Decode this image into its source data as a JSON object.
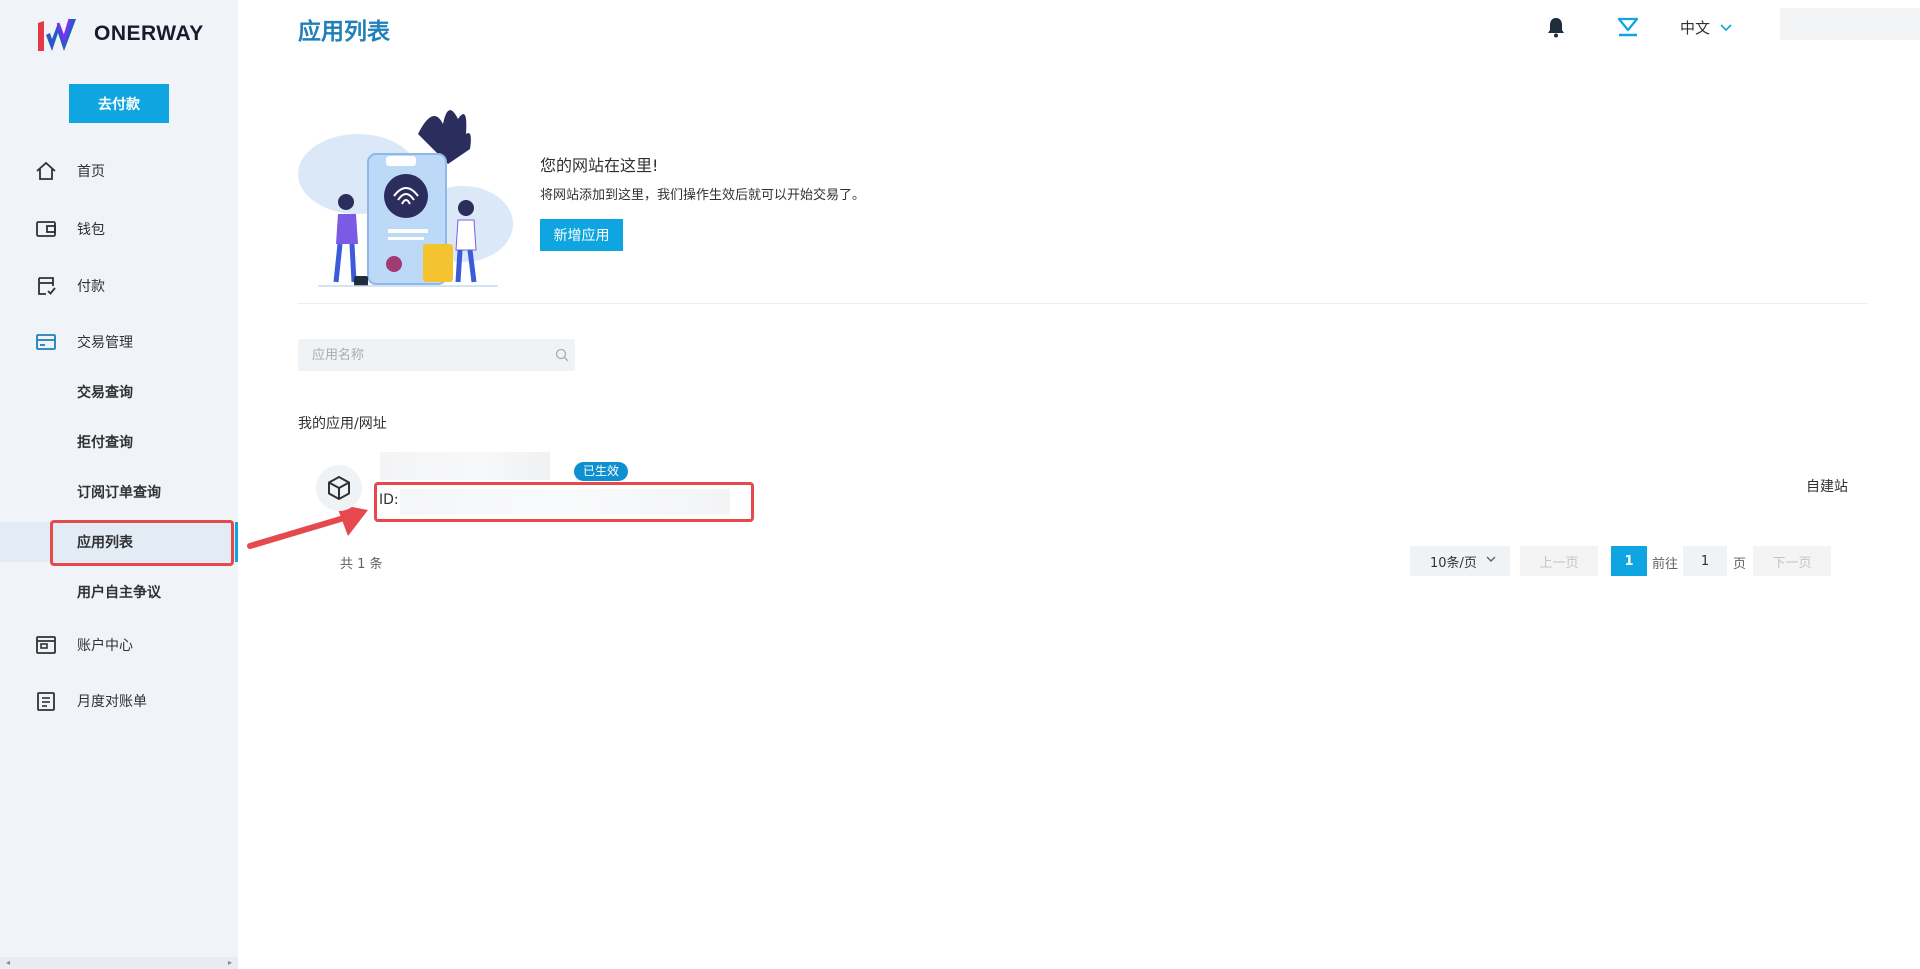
{
  "brand": {
    "name": "ONERWAY",
    "accent": "#0ea5e0",
    "title_color": "#1f7fb8"
  },
  "sidebar": {
    "pay_button": "去付款",
    "items": [
      {
        "label": "首页",
        "icon": "home-icon"
      },
      {
        "label": "钱包",
        "icon": "wallet-icon"
      },
      {
        "label": "付款",
        "icon": "payment-icon"
      },
      {
        "label": "交易管理",
        "icon": "card-icon"
      },
      {
        "label": "账户中心",
        "icon": "account-icon"
      },
      {
        "label": "月度对账单",
        "icon": "statement-icon"
      }
    ],
    "sub_items": [
      {
        "label": "交易查询"
      },
      {
        "label": "拒付查询"
      },
      {
        "label": "订阅订单查询"
      },
      {
        "label": "应用列表",
        "active": true
      },
      {
        "label": "用户自主争议"
      }
    ]
  },
  "header": {
    "title": "应用列表",
    "language": "中文"
  },
  "hero": {
    "heading": "您的网站在这里!",
    "description": "将网站添加到这里，我们操作生效后就可以开始交易了。",
    "new_app_button": "新增应用"
  },
  "search": {
    "placeholder": "应用名称"
  },
  "list": {
    "section_label": "我的应用/网址",
    "apps": [
      {
        "status": "已生效",
        "id_label": "ID: 1",
        "type": "自建站"
      }
    ]
  },
  "pagination": {
    "total": "共 1 条",
    "page_size": "10条/页",
    "prev": "上一页",
    "current": "1",
    "goto_label": "前往",
    "goto_value": "1",
    "page_suffix": "页",
    "next": "下一页"
  }
}
